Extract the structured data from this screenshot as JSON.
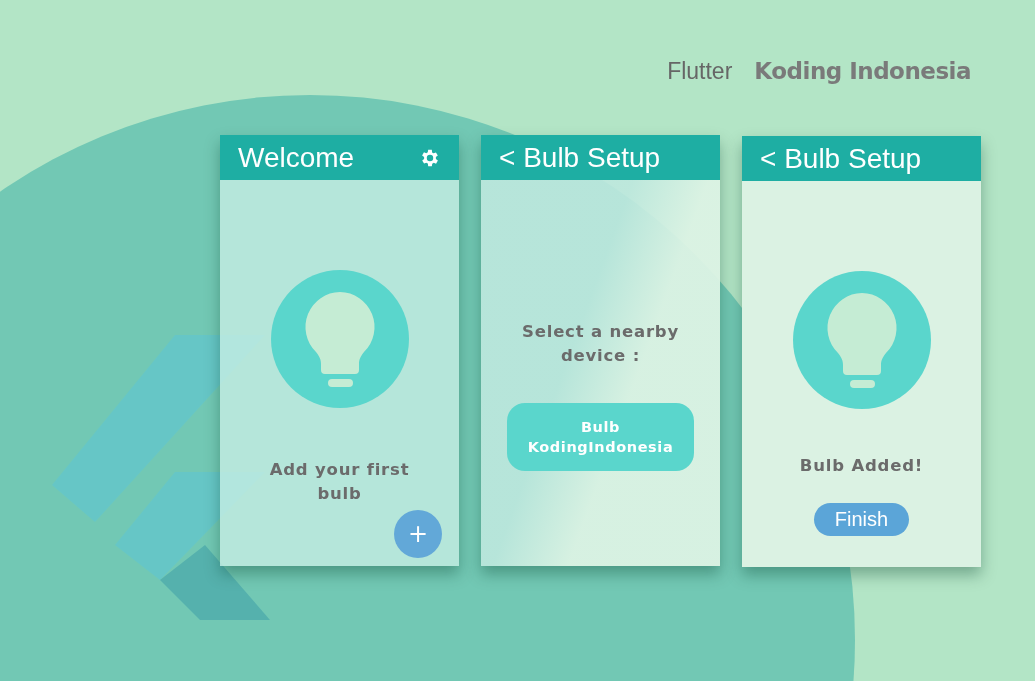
{
  "brand": {
    "framework": "Flutter",
    "logo": "Koding Indonesia"
  },
  "screens": [
    {
      "kind": "welcome",
      "title": "Welcome",
      "message": "Add your first bulb",
      "action": "+"
    },
    {
      "kind": "select",
      "title": "< Bulb Setup",
      "message": "Select a nearby device :",
      "action": "Bulb KodingIndonesia"
    },
    {
      "kind": "added",
      "title": "< Bulb Setup",
      "message": "Bulb Added!",
      "action": "Finish"
    }
  ]
}
